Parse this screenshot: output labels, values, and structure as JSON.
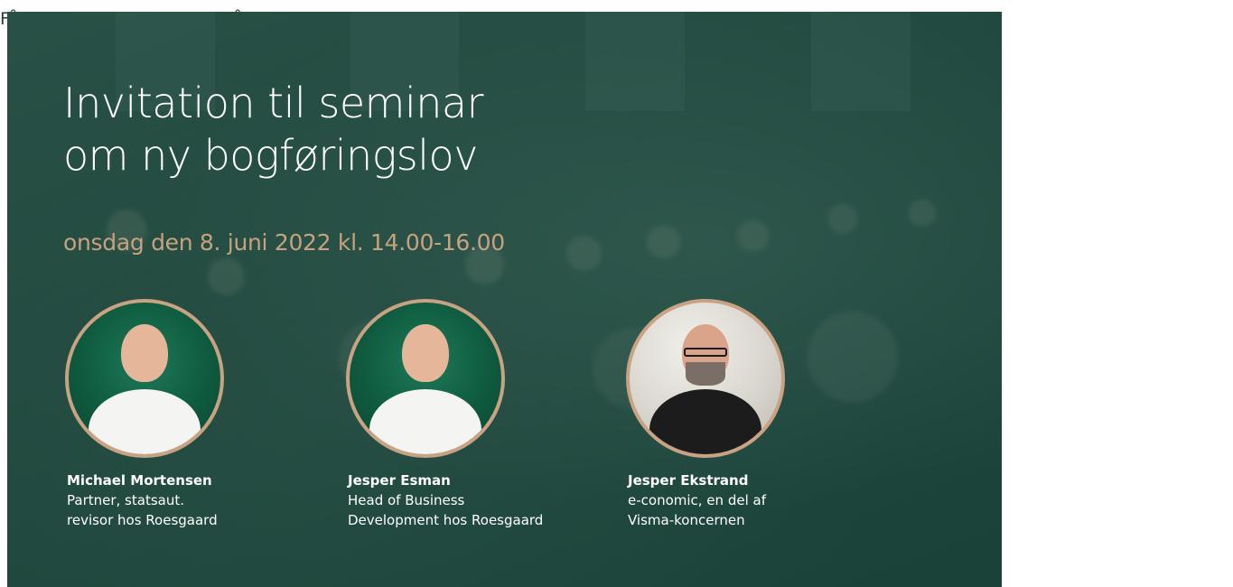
{
  "page": {
    "background_text": "Få en grundlæggende forståelse af den nye lov om digital bogføring i ti temaer, systemer og et indblik i"
  },
  "banner": {
    "title_line_1": "Invitation til seminar",
    "title_line_2": "om ny bogføringslov",
    "date": "onsdag den 8. juni 2022 kl. 14.00-16.00",
    "colors": {
      "overlay": "#0e3e32",
      "accent": "#c7a27f",
      "avatar_ring": "#c9a283",
      "text": "#ffffff"
    },
    "speakers": [
      {
        "name": "Michael Mortensen",
        "role_line_1": "Partner, statsaut.",
        "role_line_2": "revisor hos Roesgaard"
      },
      {
        "name": "Jesper Esman",
        "role_line_1": "Head of Business",
        "role_line_2": "Development hos Roesgaard"
      },
      {
        "name": "Jesper Ekstrand",
        "role_line_1": "e-conomic, en del af",
        "role_line_2": "Visma-koncernen"
      }
    ]
  }
}
